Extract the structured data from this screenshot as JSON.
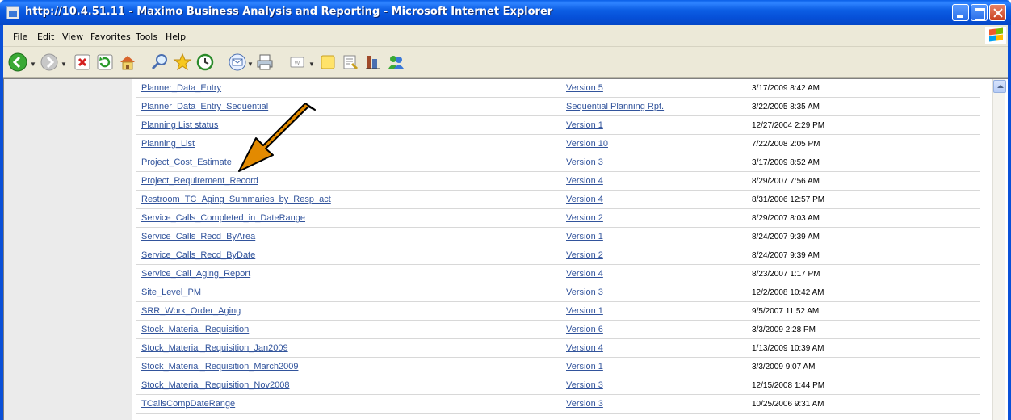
{
  "window": {
    "title": "http://10.4.51.11 - Maximo Business Analysis and Reporting - Microsoft Internet Explorer"
  },
  "menu": {
    "items": [
      "File",
      "Edit",
      "View",
      "Favorites",
      "Tools",
      "Help"
    ]
  },
  "toolbar": {
    "buttons": [
      {
        "name": "back-icon"
      },
      {
        "name": "forward-icon"
      },
      {
        "name": "stop-icon"
      },
      {
        "name": "refresh-icon"
      },
      {
        "name": "home-icon"
      },
      {
        "name": "search-icon"
      },
      {
        "name": "favorites-icon"
      },
      {
        "name": "history-icon"
      },
      {
        "name": "mail-icon"
      },
      {
        "name": "print-icon"
      },
      {
        "name": "edit-icon"
      },
      {
        "name": "discuss-icon"
      },
      {
        "name": "research-icon"
      },
      {
        "name": "messenger-icon"
      }
    ]
  },
  "colors": {
    "link": "#32549c",
    "arrow": "#e38a00",
    "titlebar": "#0650d8"
  },
  "reports": [
    {
      "name": "Planner_Data_Entry",
      "version": "Version 5",
      "date": "3/17/2009 8:42 AM"
    },
    {
      "name": "Planner_Data_Entry_Sequential",
      "version": "Sequential Planning Rpt.",
      "date": "3/22/2005 8:35 AM"
    },
    {
      "name": "Planning List status",
      "version": "Version 1",
      "date": "12/27/2004 2:29 PM"
    },
    {
      "name": "Planning_List",
      "version": "Version 10",
      "date": "7/22/2008 2:05 PM"
    },
    {
      "name": "Project_Cost_Estimate",
      "version": "Version 3",
      "date": "3/17/2009 8:52 AM"
    },
    {
      "name": "Project_Requirement_Record",
      "version": "Version 4",
      "date": "8/29/2007 7:56 AM"
    },
    {
      "name": "Restroom_TC_Aging_Summaries_by_Resp_act",
      "version": "Version 4",
      "date": "8/31/2006 12:57 PM"
    },
    {
      "name": "Service_Calls_Completed_in_DateRange",
      "version": "Version 2",
      "date": "8/29/2007 8:03 AM"
    },
    {
      "name": "Service_Calls_Recd_ByArea",
      "version": "Version 1",
      "date": "8/24/2007 9:39 AM"
    },
    {
      "name": "Service_Calls_Recd_ByDate",
      "version": "Version 2",
      "date": "8/24/2007 9:39 AM"
    },
    {
      "name": "Service_Call_Aging_Report",
      "version": "Version 4",
      "date": "8/23/2007 1:17 PM"
    },
    {
      "name": "Site_Level_PM",
      "version": "Version 3",
      "date": "12/2/2008 10:42 AM"
    },
    {
      "name": "SRR_Work_Order_Aging",
      "version": "Version 1",
      "date": "9/5/2007 11:52 AM"
    },
    {
      "name": "Stock_Material_Requisition",
      "version": "Version 6",
      "date": "3/3/2009 2:28 PM"
    },
    {
      "name": "Stock_Material_Requisition_Jan2009",
      "version": "Version 4",
      "date": "1/13/2009 10:39 AM"
    },
    {
      "name": "Stock_Material_Requisition_March2009",
      "version": "Version 1",
      "date": "3/3/2009 9:07 AM"
    },
    {
      "name": "Stock_Material_Requisition_Nov2008",
      "version": "Version 3",
      "date": "12/15/2008 1:44 PM"
    },
    {
      "name": "TCallsCompDateRange",
      "version": "Version 3",
      "date": "10/25/2006 9:31 AM"
    }
  ]
}
